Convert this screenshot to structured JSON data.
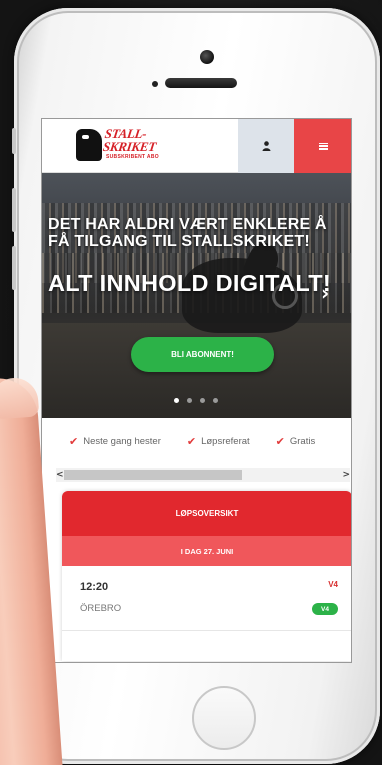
{
  "header": {
    "logo_text": "STALL-SKRIKET",
    "logo_subtext": "SUBSKRIBENT ABO",
    "user_icon": "user-icon",
    "menu_icon": "hamburger-menu-icon",
    "menu_color": "#e84547"
  },
  "hero": {
    "subtitle": "DET HAR ALDRI VÆRT ENKLERE Å FÅ TILGANG TIL STALLSKRIKET!",
    "title": "ALT INNHOLD DIGITALT!",
    "cta_label": "BLI ABONNENT!",
    "cta_color": "#2cb248",
    "next_icon": "chevron-right-icon",
    "slide_count": 4,
    "active_slide": 1
  },
  "features": [
    {
      "label": "Neste gang hester"
    },
    {
      "label": "Løpsreferat"
    },
    {
      "label": "Gratis"
    }
  ],
  "scroll": {
    "left": "<",
    "right": ">"
  },
  "race_overview": {
    "title": "LØPSOVERSIKT",
    "date": "I DAG 27. JUNI",
    "races": [
      {
        "time": "12:20",
        "venue": "ÖREBRO",
        "type": "V4",
        "badge": "V4"
      }
    ]
  }
}
